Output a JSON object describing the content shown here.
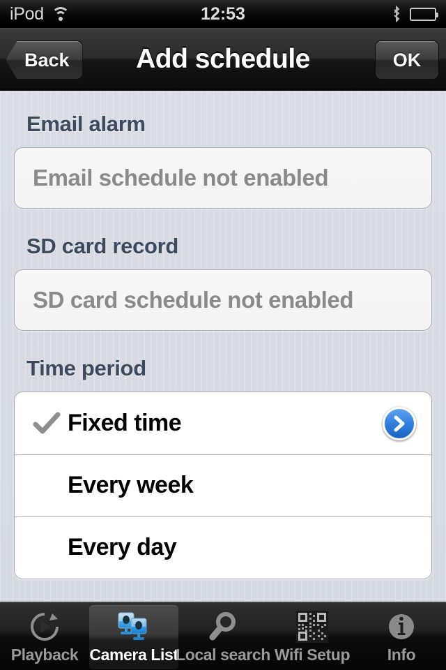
{
  "statusbar": {
    "carrier": "iPod",
    "time": "12:53",
    "wifi_icon": "wifi-icon",
    "bluetooth_icon": "bluetooth-icon",
    "battery_icon": "battery-icon"
  },
  "navbar": {
    "back_label": "Back",
    "title": "Add schedule",
    "ok_label": "OK"
  },
  "sections": {
    "email": {
      "header": "Email alarm",
      "value": "Email schedule not enabled"
    },
    "sdcard": {
      "header": "SD card record",
      "value": "SD card schedule not enabled"
    },
    "timeperiod": {
      "header": "Time period",
      "options": [
        {
          "label": "Fixed time",
          "checked": true,
          "disclosure": true
        },
        {
          "label": "Every week",
          "checked": false,
          "disclosure": false
        },
        {
          "label": "Every day",
          "checked": false,
          "disclosure": false
        }
      ],
      "checkmark_icon": "checkmark-icon",
      "disclosure_icon": "chevron-right-icon"
    }
  },
  "tabbar": {
    "selected": "Camera List",
    "tabs": [
      {
        "label": "Playback",
        "icon": "replay-play-icon"
      },
      {
        "label": "Camera List",
        "icon": "cameras-icon"
      },
      {
        "label": "Local search",
        "icon": "magnifier-icon"
      },
      {
        "label": "Wifi Setup",
        "icon": "qr-code-icon"
      },
      {
        "label": "Info",
        "icon": "info-icon"
      }
    ]
  },
  "colors": {
    "accent_blue": "#2f7ddb",
    "page_bg": "#d9dce4",
    "header_text": "#3d4a5d",
    "disabled_text": "#8a8a8a"
  }
}
